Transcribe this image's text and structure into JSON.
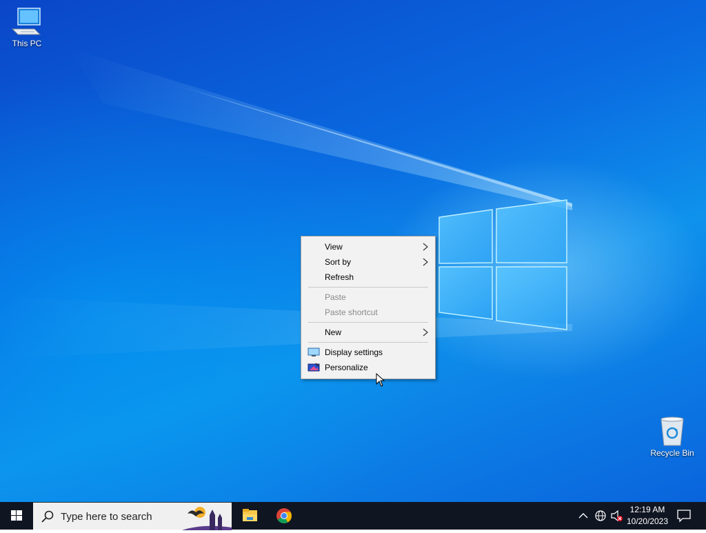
{
  "desktop": {
    "icons": [
      {
        "label": "This PC",
        "icon": "computer-icon"
      },
      {
        "label": "Recycle Bin",
        "icon": "recycle-bin-icon"
      }
    ],
    "wallpaper_colors": {
      "primary": "#0a6ae0",
      "light": "#6cc6ff",
      "dark": "#0a46c8"
    }
  },
  "context_menu": {
    "items": [
      {
        "label": "View",
        "has_submenu": true,
        "enabled": true
      },
      {
        "label": "Sort by",
        "has_submenu": true,
        "enabled": true
      },
      {
        "label": "Refresh",
        "has_submenu": false,
        "enabled": true
      },
      {
        "label": "Paste",
        "has_submenu": false,
        "enabled": false
      },
      {
        "label": "Paste shortcut",
        "has_submenu": false,
        "enabled": false
      },
      {
        "label": "New",
        "has_submenu": true,
        "enabled": true
      },
      {
        "label": "Display settings",
        "icon": "display-settings-icon",
        "enabled": true
      },
      {
        "label": "Personalize",
        "icon": "personalize-icon",
        "enabled": true
      }
    ]
  },
  "taskbar": {
    "search_placeholder": "Type here to search",
    "pinned_apps": [
      "file-explorer-icon",
      "chrome-icon"
    ],
    "tray": {
      "icons": [
        "show-hidden-icons-chevron",
        "network-icon",
        "volume-muted-icon"
      ]
    },
    "clock": {
      "time": "12:19 AM",
      "date": "10/20/2023"
    }
  }
}
